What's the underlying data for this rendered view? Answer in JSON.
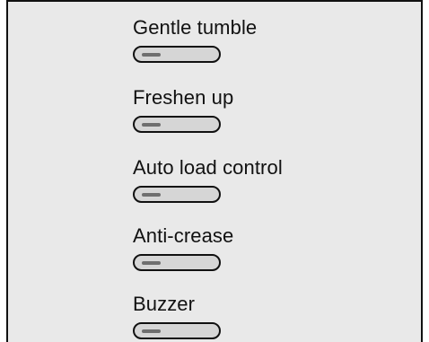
{
  "options": [
    {
      "label": "Gentle tumble",
      "state": "off"
    },
    {
      "label": "Freshen up",
      "state": "off"
    },
    {
      "label": "Auto load control",
      "state": "off"
    },
    {
      "label": "Anti-crease",
      "state": "off"
    },
    {
      "label": "Buzzer",
      "state": "off"
    }
  ]
}
